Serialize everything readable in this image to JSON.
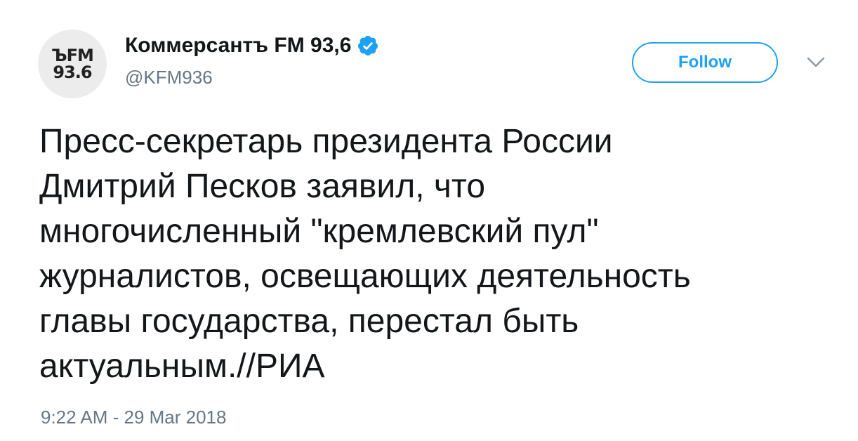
{
  "account": {
    "avatar_logo_top": "ЪFM",
    "avatar_logo_bottom": "93.6",
    "display_name": "Коммерсантъ FM 93,6",
    "handle": "@KFM936",
    "verified": true
  },
  "actions": {
    "follow_label": "Follow"
  },
  "tweet": {
    "lines": [
      "Пресс-секретарь президента России",
      "Дмитрий Песков заявил, что",
      "многочисленный \"кремлевский пул\"",
      "журналистов, освещающих деятельность",
      "главы государства, перестал быть",
      "актуальным.//РИА"
    ],
    "timestamp": "9:22 AM - 29 Mar 2018"
  },
  "icons": {
    "verified": "verified-badge-icon",
    "chevron": "chevron-down-icon"
  },
  "colors": {
    "accent": "#1da1f2",
    "text": "#14171a",
    "secondary": "#657786"
  }
}
